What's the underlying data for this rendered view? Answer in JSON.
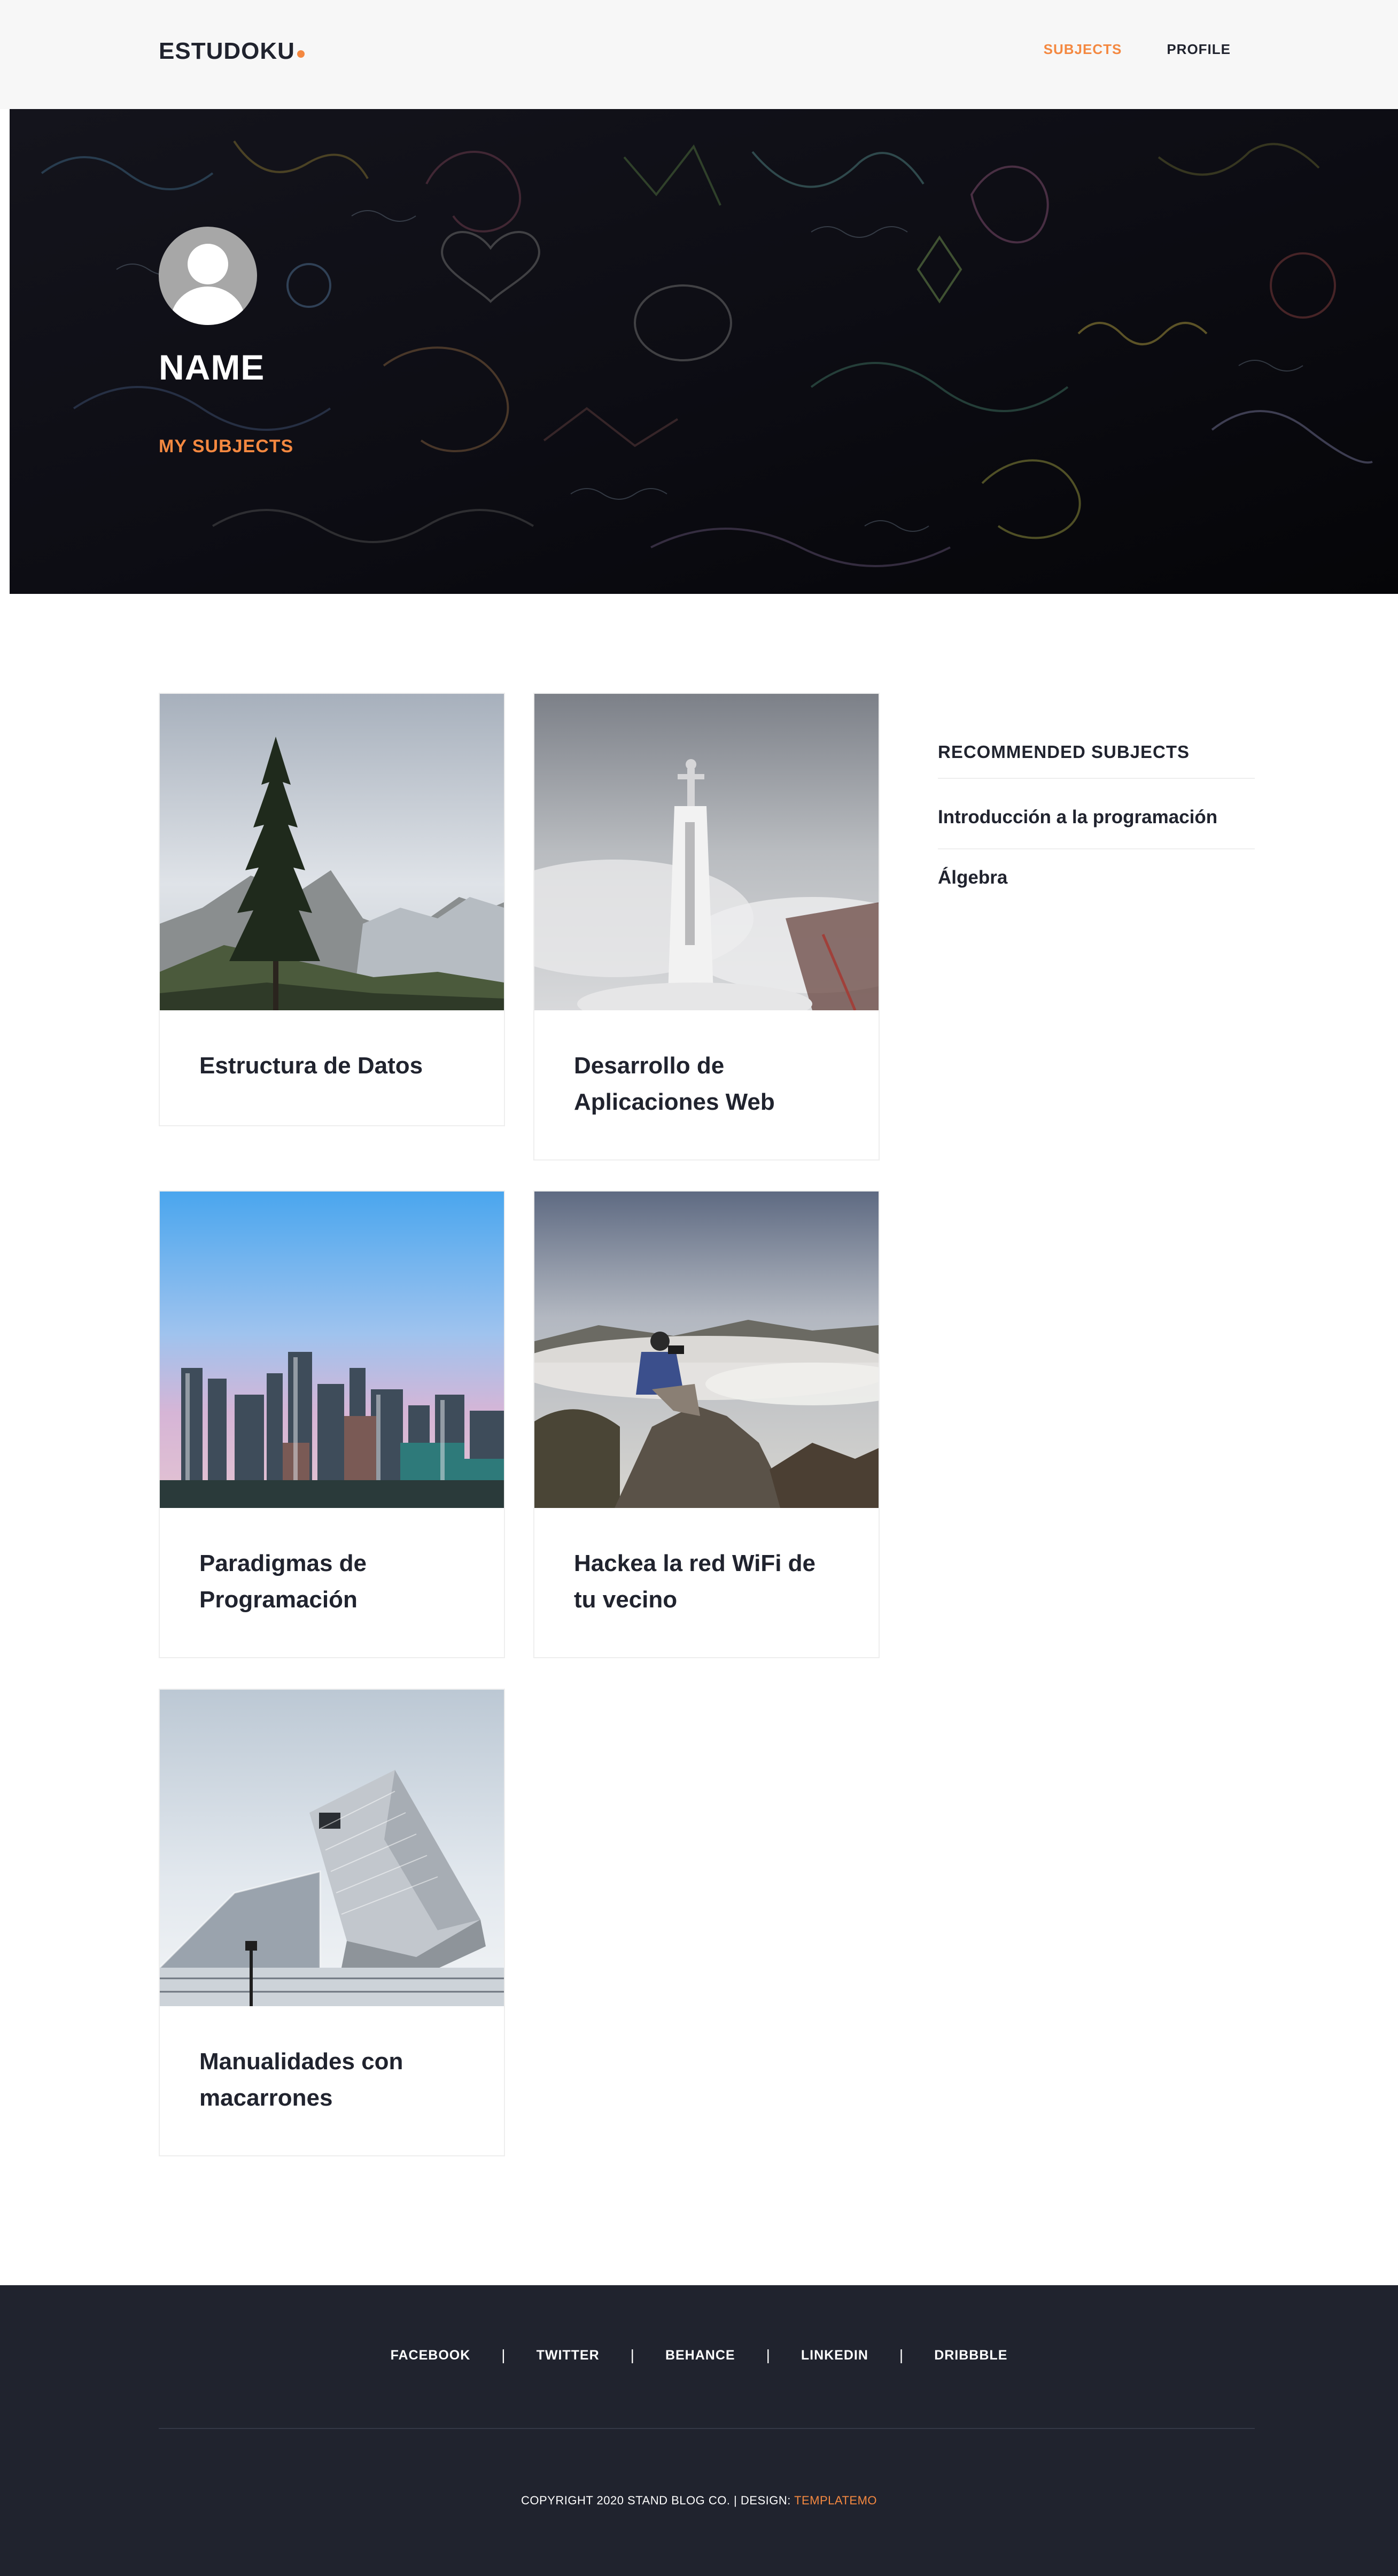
{
  "header": {
    "logo": "ESTUDOKU",
    "nav": [
      {
        "label": "SUBJECTS",
        "active": true
      },
      {
        "label": "PROFILE",
        "active": false
      }
    ]
  },
  "hero": {
    "name": "NAME",
    "subtitle": "MY SUBJECTS"
  },
  "subjects": [
    {
      "title": "Estructura de Datos",
      "image": "mountain-pine-tree-photo"
    },
    {
      "title": "Desarrollo de Aplicaciones Web",
      "image": "statue-above-clouds-photo"
    },
    {
      "title": "Paradigmas de Programación",
      "image": "city-skyline-photo"
    },
    {
      "title": "Hackea la red WiFi de tu vecino",
      "image": "photographer-on-rock-photo"
    },
    {
      "title": "Manualidades con macarrones",
      "image": "modern-building-photo"
    }
  ],
  "sidebar": {
    "heading": "RECOMMENDED SUBJECTS",
    "items": [
      "Introducción a la programación",
      "Álgebra"
    ]
  },
  "footer": {
    "social": [
      "FACEBOOK",
      "TWITTER",
      "BEHANCE",
      "LINKEDIN",
      "DRIBBBLE"
    ],
    "separator": "|",
    "copyright": "COPYRIGHT 2020 STAND BLOG CO. | DESIGN: ",
    "design_link": "TEMPLATEMO"
  },
  "colors": {
    "accent": "#f48840",
    "dark": "#20232e",
    "header_bg": "#f7f7f7"
  }
}
